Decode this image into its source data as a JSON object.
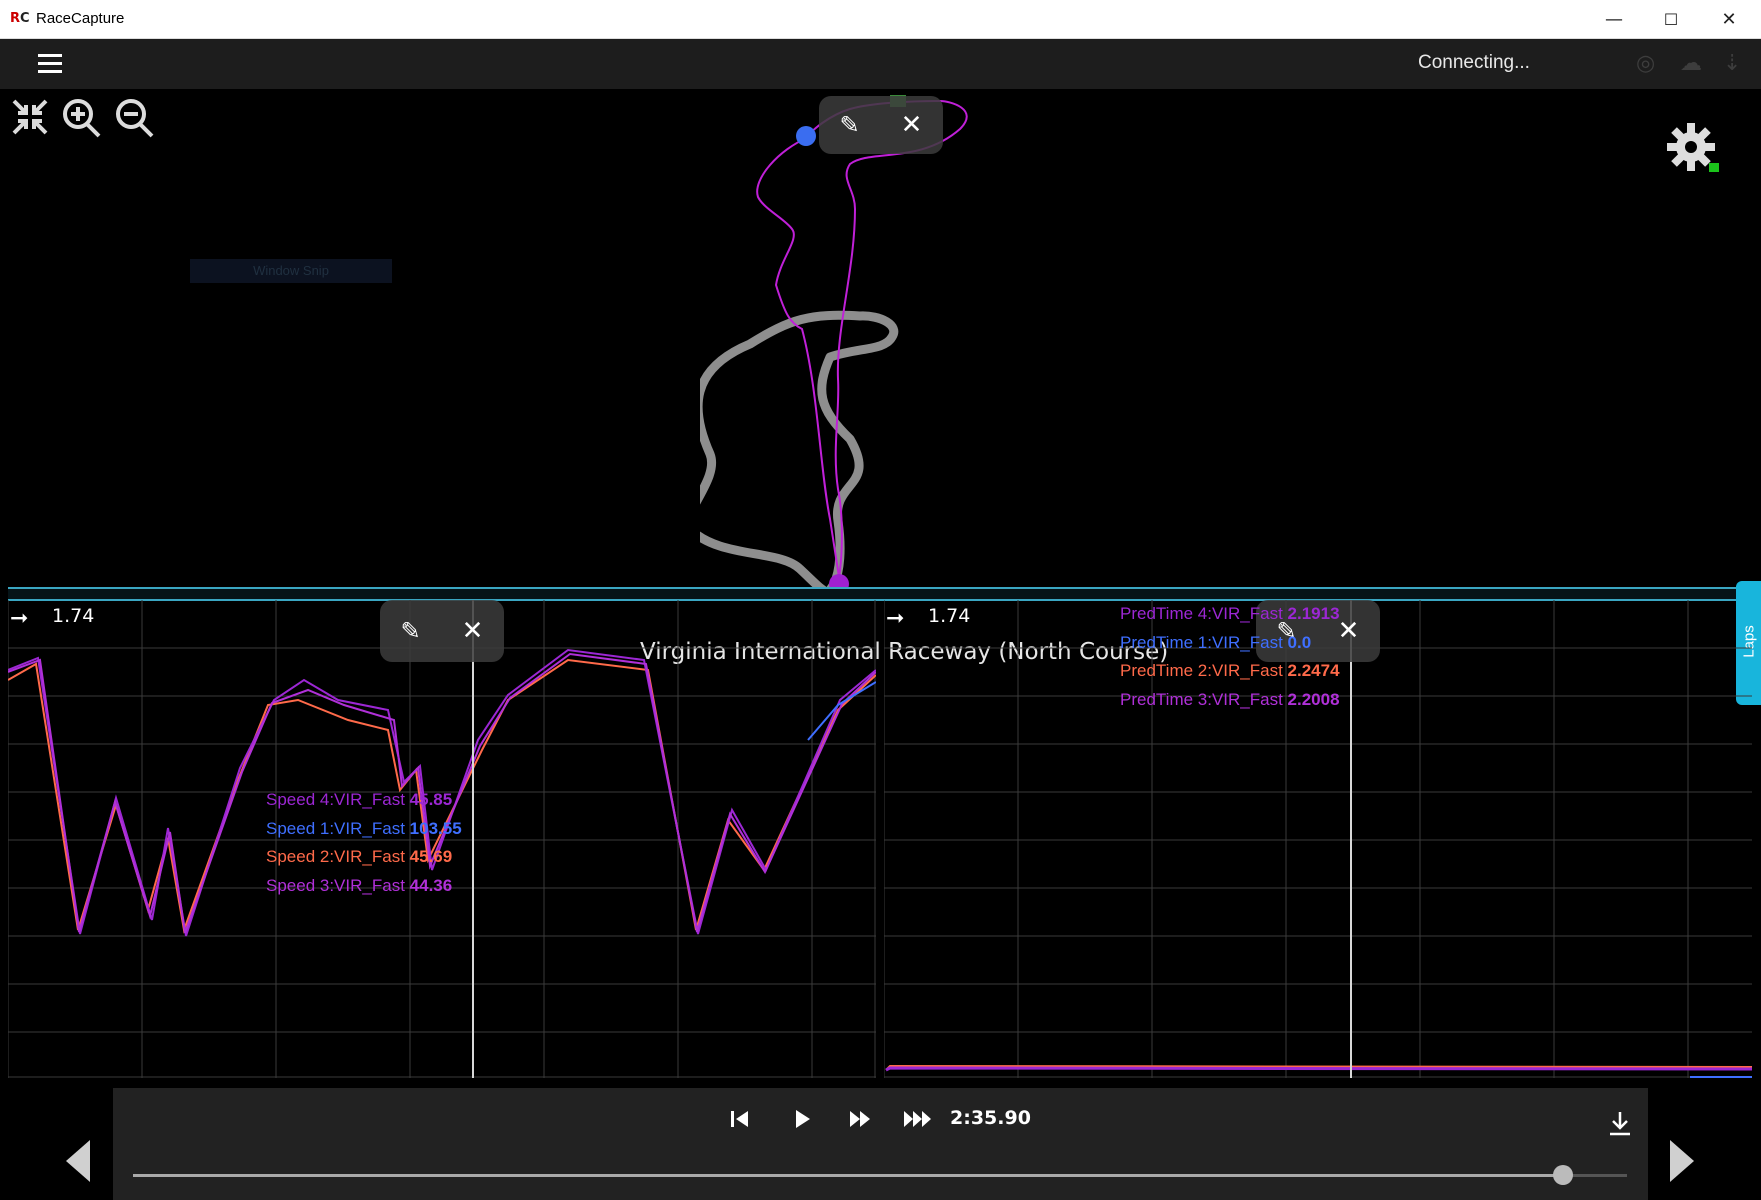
{
  "window": {
    "app_logo": "RC",
    "title": "RaceCapture",
    "minimize_glyph": "—",
    "maximize_glyph": "☐",
    "close_glyph": "✕"
  },
  "appbar": {
    "menu_icon": "hamburger-menu-icon",
    "status": "Connecting...",
    "status_icons": [
      "gps-icon",
      "cloud-upload-icon",
      "log-download-icon"
    ]
  },
  "map": {
    "tools": [
      "fit-screen-icon",
      "zoom-in-icon",
      "zoom-out-icon"
    ],
    "snip_label": "Window Snip",
    "track_name": "Virginia International Raceway (North Course)",
    "settings_icon": "gear-icon",
    "overlay_icons": [
      "edit-icon",
      "close-icon"
    ]
  },
  "left_chart": {
    "marker_value": "1.74",
    "legend": [
      {
        "label": "Speed 4:VIR_Fast",
        "value": "45.85",
        "color": "#9c27d4"
      },
      {
        "label": "Speed 1:VIR_Fast",
        "value": "103.55",
        "color": "#3f6fff"
      },
      {
        "label": "Speed 2:VIR_Fast",
        "value": "45.69",
        "color": "#ff6a4a"
      },
      {
        "label": "Speed 3:VIR_Fast",
        "value": "44.36",
        "color": "#b030d8"
      }
    ]
  },
  "right_chart": {
    "marker_value": "1.74",
    "legend": [
      {
        "label": "PredTime 4:VIR_Fast",
        "value": "2.1913",
        "color": "#9c27d4"
      },
      {
        "label": "PredTime 1:VIR_Fast",
        "value": "0.0",
        "color": "#3f6fff"
      },
      {
        "label": "PredTime 2:VIR_Fast",
        "value": "2.2474",
        "color": "#ff6a4a"
      },
      {
        "label": "PredTime 3:VIR_Fast",
        "value": "2.2008",
        "color": "#b030d8"
      }
    ]
  },
  "laps_tab": "Laps",
  "playback": {
    "time": "2:35.90",
    "progress": 0.957,
    "buttons": [
      "skip-start-icon",
      "play-icon",
      "fast-forward-icon",
      "faster-forward-icon",
      "download-icon"
    ]
  },
  "nav": {
    "prev_icon": "prev-arrow-icon",
    "next_icon": "next-arrow-icon"
  },
  "colors": {
    "accent": "#18b5dc",
    "splitter": "#3aa6c2"
  }
}
